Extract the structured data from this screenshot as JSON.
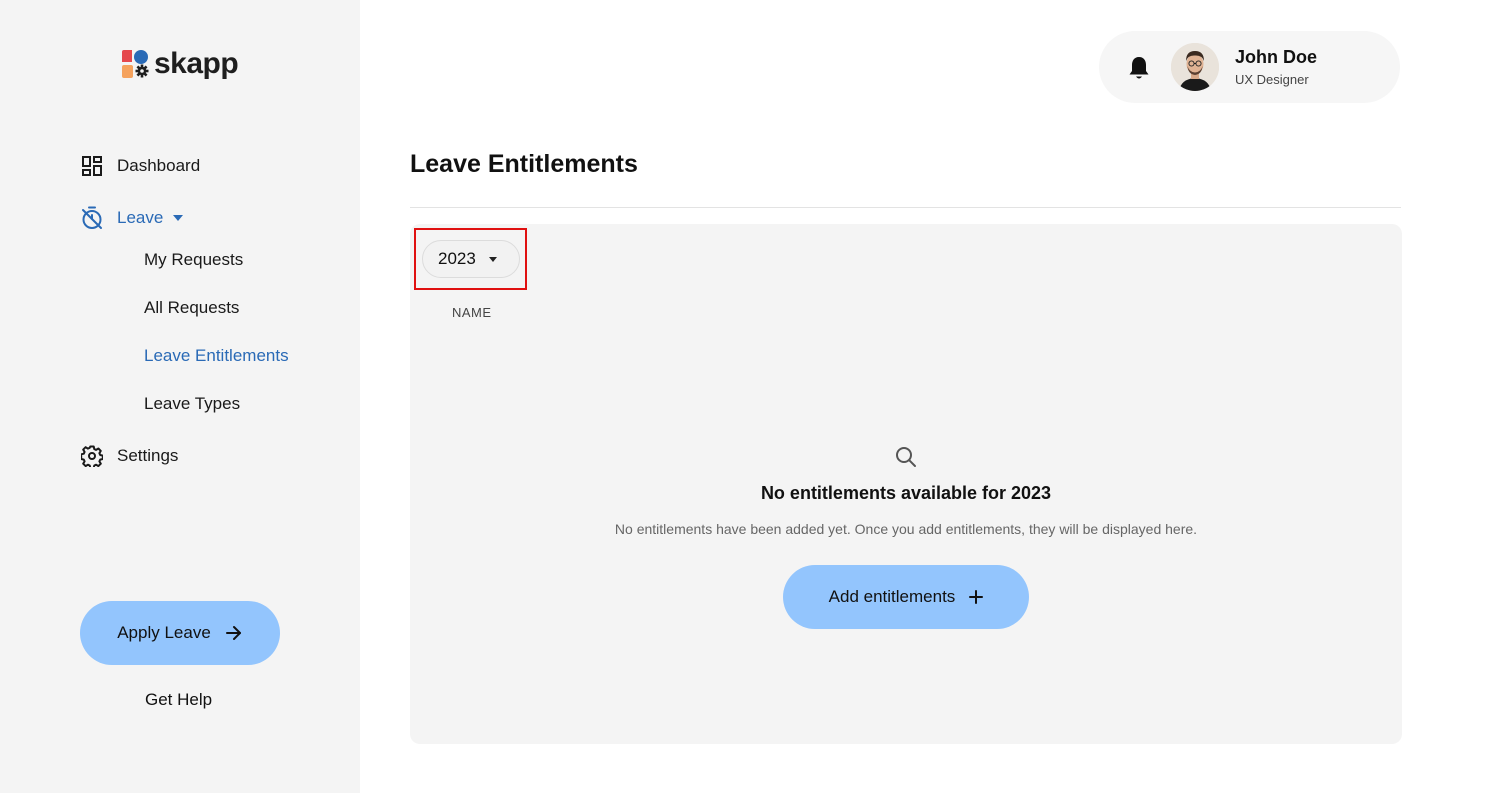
{
  "brand": {
    "name": "skapp",
    "colors": {
      "red": "#e5484d",
      "blue": "#2a6ab6",
      "orange": "#f5a25d"
    }
  },
  "sidebar": {
    "items": [
      {
        "label": "Dashboard",
        "icon": "dashboard-grid-icon"
      },
      {
        "label": "Leave",
        "icon": "timer-off-icon",
        "expanded": true,
        "children": [
          {
            "label": "My Requests"
          },
          {
            "label": "All Requests"
          },
          {
            "label": "Leave Entitlements",
            "active": true
          },
          {
            "label": "Leave Types"
          }
        ]
      },
      {
        "label": "Settings",
        "icon": "gear-icon"
      }
    ],
    "apply_label": "Apply Leave",
    "help_label": "Get Help"
  },
  "header": {
    "user_name": "John Doe",
    "user_role": "UX Designer",
    "bell_icon": "bell-icon"
  },
  "main": {
    "title": "Leave Entitlements",
    "year_selected": "2023",
    "column_name": "NAME",
    "empty_title": "No entitlements available for 2023",
    "empty_desc": "No entitlements have been added yet. Once you add entitlements, they will be displayed here.",
    "add_label": "Add entitlements"
  },
  "colors": {
    "accent": "#2a6ab6",
    "button": "#93c5fd",
    "sidebar_bg": "#f4f4f4",
    "panel_bg": "#f4f4f4",
    "highlight": "#e01010"
  }
}
